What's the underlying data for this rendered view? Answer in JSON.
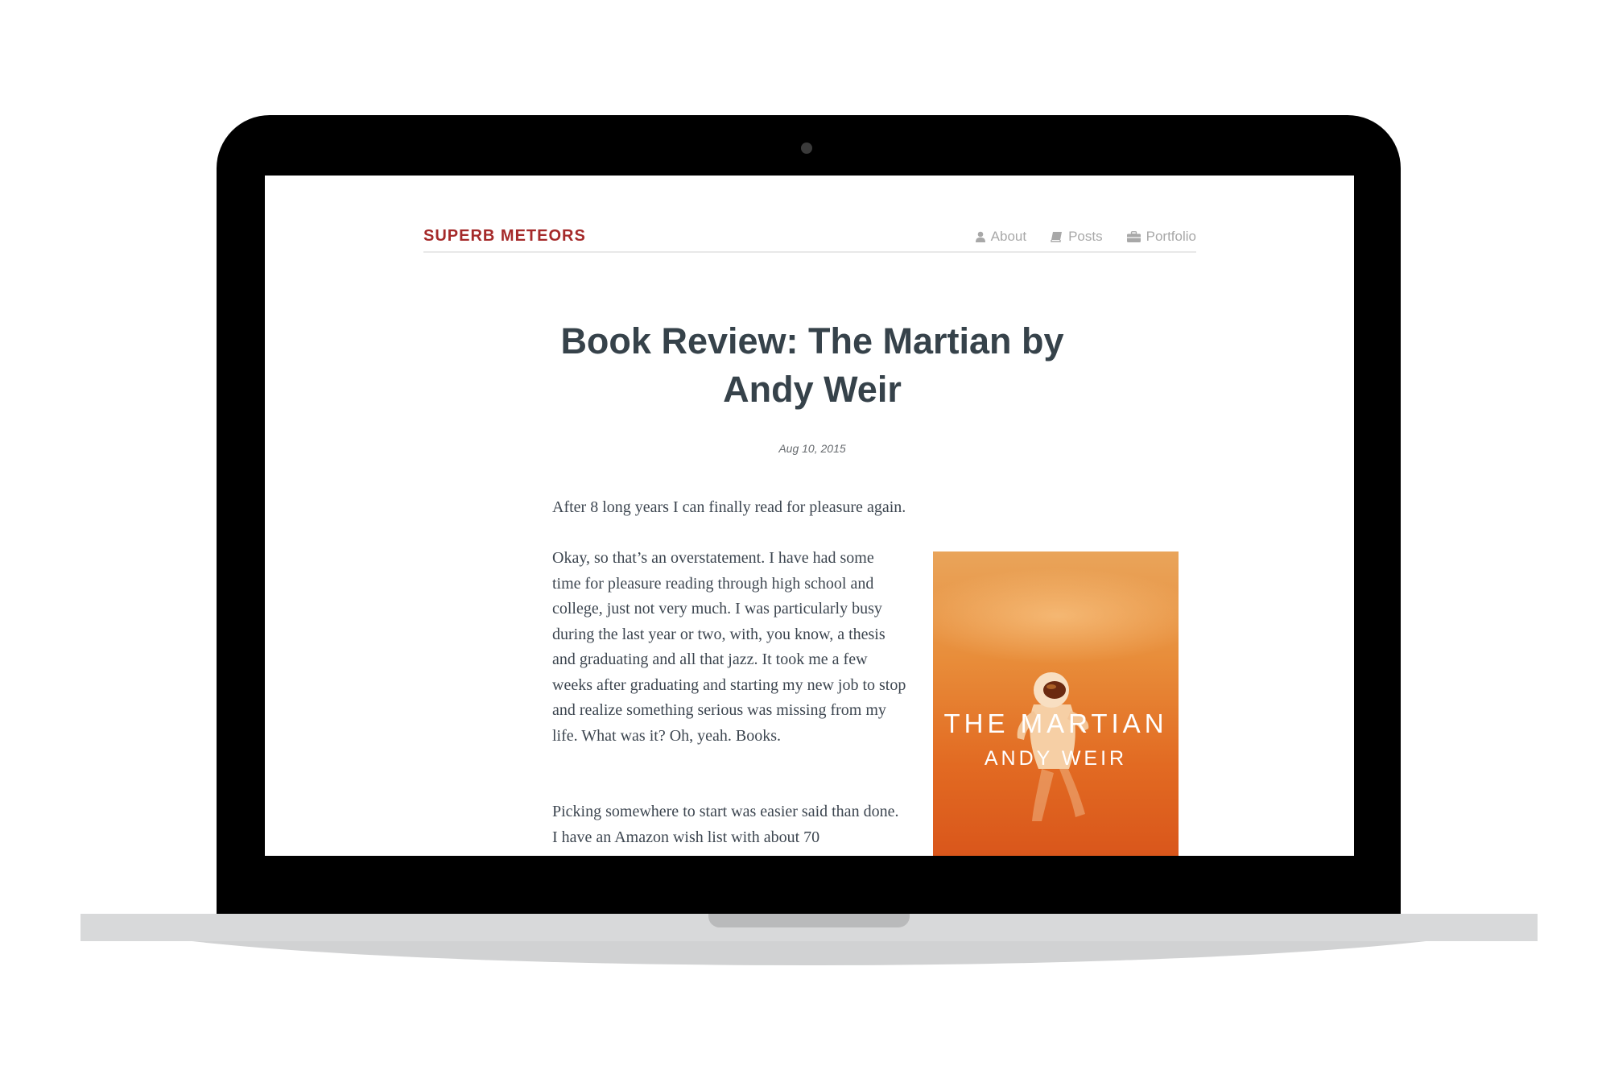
{
  "site": {
    "title": "SUPERB METEORS"
  },
  "nav": {
    "items": [
      {
        "label": "About",
        "icon": "user-icon"
      },
      {
        "label": "Posts",
        "icon": "book-icon"
      },
      {
        "label": "Portfolio",
        "icon": "briefcase-icon"
      }
    ]
  },
  "post": {
    "title": "Book Review: The Martian by Andy Weir",
    "date": "Aug 10, 2015",
    "paragraphs": [
      "After 8 long years I can finally read for pleasure again.",
      "Okay, so that’s an overstatement. I have had some time for pleasure reading through high school and college, just not very much. I was particularly busy during the last year or two, with, you know, a thesis and graduating and all that jazz. It took me a few weeks after graduating and starting my new job to stop and realize something serious was missing from my life. What was it? Oh, yeah. Books.",
      "Picking somewhere to start was easier said than done. I have an Amazon wish list with about 70"
    ],
    "cover": {
      "title": "THE MARTIAN",
      "author": "ANDY WEIR"
    }
  },
  "colors": {
    "accent": "#a52a2a",
    "heading": "#36424a",
    "body_text": "#3d4650",
    "nav_text": "#a8a8a8",
    "cover": "#e26a22"
  }
}
